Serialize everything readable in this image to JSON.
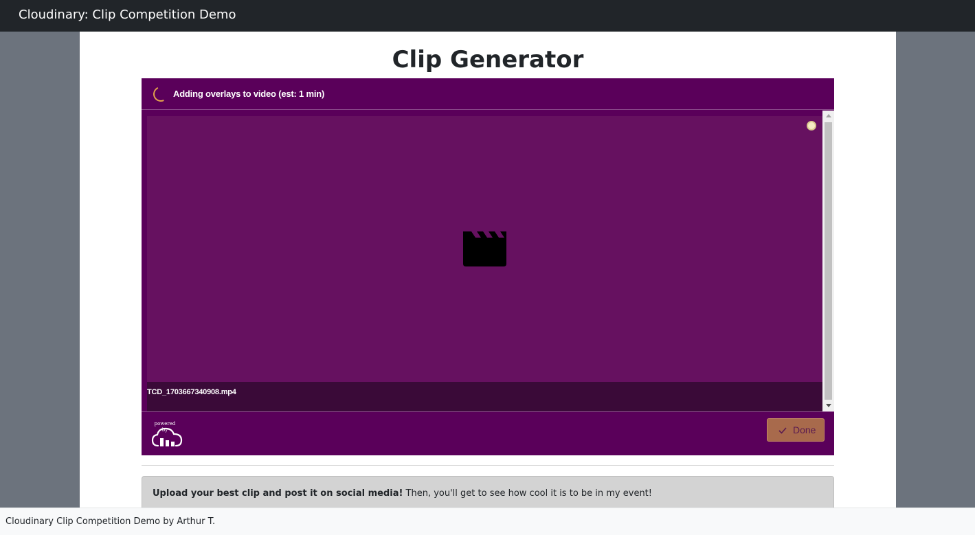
{
  "navbar": {
    "brand": "Cloudinary: Clip Competition Demo"
  },
  "page": {
    "title": "Clip Generator"
  },
  "widget": {
    "status": "Adding overlays to video (est: 1 min)",
    "file_name": "TCD_1703667340908.mp4",
    "powered_by": "powered by",
    "done_label": "Done",
    "colors": {
      "panel": "#5a005a",
      "video": "#661160",
      "file_bar": "#3a0a38",
      "spinner": "#e2a34c",
      "done_button": "#a86a4c"
    },
    "icons": {
      "status": "spinner-icon",
      "video": "film-clapper-icon",
      "logo": "cloudinary-cloud-logo",
      "done": "checkmark-icon"
    }
  },
  "info": {
    "bold_text": "Upload your best clip and post it on social media!",
    "text": " Then, you'll get to see how cool it is to be in my event!"
  },
  "footer": {
    "text": "Cloudinary Clip Competition Demo by Arthur T."
  }
}
